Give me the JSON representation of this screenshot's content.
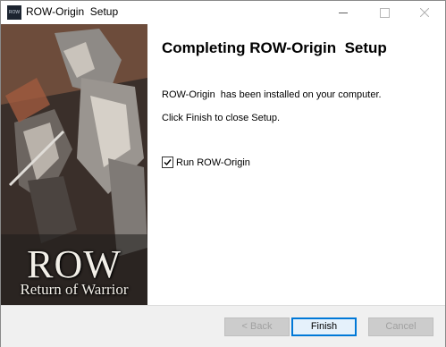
{
  "window": {
    "title": "ROW-Origin  Setup",
    "icon_text": "ROW"
  },
  "banner": {
    "logo": "ROW",
    "subtitle": "Return of Warrior"
  },
  "content": {
    "heading": "Completing ROW-Origin  Setup",
    "installed_text": "ROW-Origin  has been installed on your computer.",
    "finish_text": "Click Finish to close Setup.",
    "run_label": "Run ROW-Origin",
    "run_checked": true
  },
  "buttons": {
    "back": "< Back",
    "finish": "Finish",
    "cancel": "Cancel"
  },
  "colors": {
    "accent": "#0078d7",
    "footer_bg": "#f0f0f0",
    "disabled_text": "#a0a0a0"
  }
}
